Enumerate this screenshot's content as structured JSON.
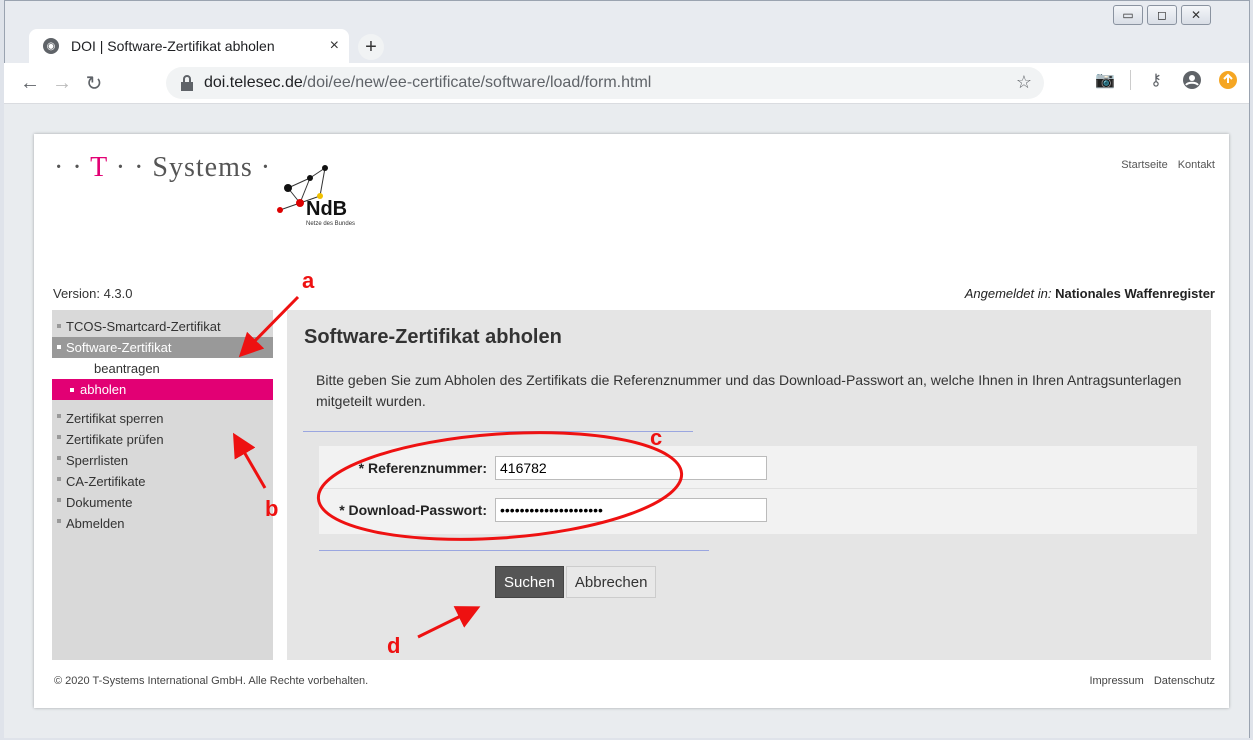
{
  "browser": {
    "tab_title": "DOI | Software-Zertifikat abholen",
    "tab_close": "×",
    "new_tab": "+",
    "url_host": "doi.telesec.de",
    "url_path": "/doi/ee/new/ee-certificate/software/load/form.html",
    "window_buttons": [
      "▭",
      "◻",
      "✕"
    ]
  },
  "header": {
    "logo_text_prefix": "· · ",
    "logo_t": "T",
    "logo_text_suffix": " · · Systems ·",
    "ndb_label": "NdB",
    "ndb_sub": "Netze des Bundes",
    "links": [
      "Startseite",
      "Kontakt"
    ]
  },
  "info": {
    "version": "Version: 4.3.0",
    "angemeldet_label": "Angemeldet in:",
    "angemeldet_value": "Nationales Waffenregister"
  },
  "sidebar": {
    "items": [
      {
        "label": "TCOS-Smartcard-Zertifikat"
      },
      {
        "label": "Software-Zertifikat",
        "active": true
      },
      {
        "label": "beantragen",
        "sub": true
      },
      {
        "label": "abholen",
        "sub": true,
        "selected": true
      },
      {
        "label": "Zertifikat sperren"
      },
      {
        "label": "Zertifikate prüfen"
      },
      {
        "label": "Sperrlisten"
      },
      {
        "label": "CA-Zertifikate"
      },
      {
        "label": "Dokumente"
      },
      {
        "label": "Abmelden"
      }
    ]
  },
  "main": {
    "title": "Software-Zertifikat abholen",
    "description": "Bitte geben Sie zum Abholen des Zertifikats die Referenznummer und das Download-Passwort an, welche Ihnen in Ihren Antragsunterlagen mitgeteilt wurden.",
    "form": {
      "ref_label": "* Referenznummer:",
      "ref_value": "416782",
      "pw_label": "* Download-Passwort:",
      "pw_value": "•••••••••••••••••••••"
    },
    "search_button": "Suchen",
    "cancel_button": "Abbrechen"
  },
  "footer": {
    "copyright": "© 2020 T-Systems International GmbH. Alle Rechte vorbehalten.",
    "links": [
      "Impressum",
      "Datenschutz"
    ]
  },
  "annotations": {
    "labels": [
      "a",
      "b",
      "c",
      "d"
    ],
    "color": "#e11111"
  }
}
